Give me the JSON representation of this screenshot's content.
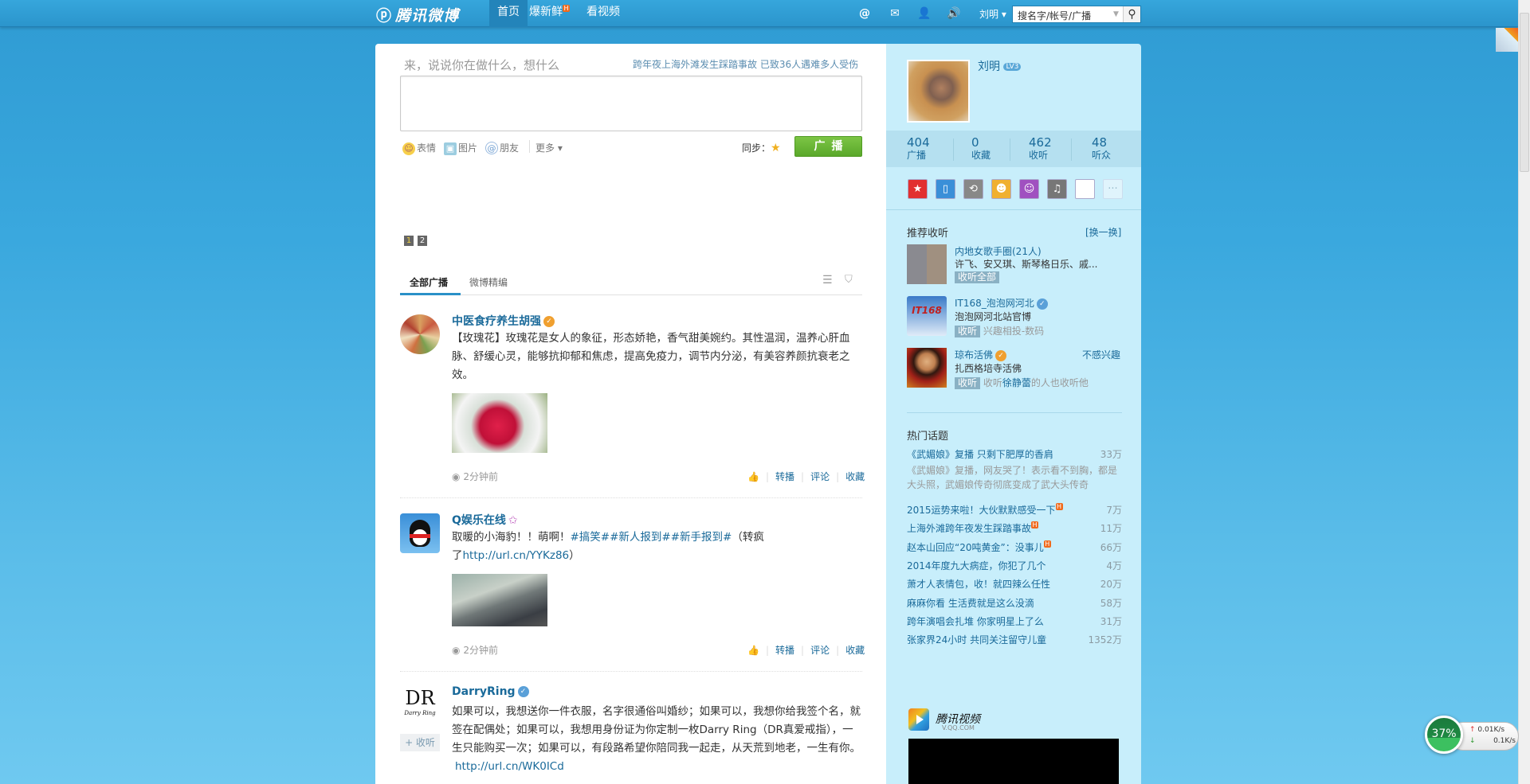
{
  "topbar": {
    "logo": "腾讯微博",
    "nav": [
      {
        "label": "首页",
        "active": true
      },
      {
        "label": "爆新鲜",
        "badge": "H"
      },
      {
        "label": "看视频"
      }
    ],
    "icons": [
      "at-icon",
      "mail-icon",
      "user-icon",
      "sound-icon"
    ],
    "user": "刘明",
    "search_placeholder": "搜名字/帐号/广播"
  },
  "composer": {
    "placeholder": "来，说说你在做什么，想什么",
    "hot_news": "跨年夜上海外滩发生踩踏事故  已致36人遇难多人受伤",
    "tools": [
      "表情",
      "图片",
      "朋友",
      "更多"
    ],
    "sync_label": "同步：",
    "post_button": "广播"
  },
  "pager": [
    "1",
    "2"
  ],
  "tabs": [
    "全部广播",
    "微博精编"
  ],
  "posts": [
    {
      "name": "中医食疗养生胡强",
      "badge": "verified-orange",
      "text": "【玫瑰花】玫瑰花是女人的象征，形态娇艳，香气甜美婉约。其性温润，温养心肝血脉、舒缓心灵，能够抗抑郁和焦虑，提高免疫力，调节内分泌，有美容养颜抗衰老之效。",
      "time": "2分钟前"
    },
    {
      "name": "Q娱乐在线",
      "badge": "star",
      "text_pre": "取暖的小海豹！！萌啊！",
      "tags": "#搞笑##新人报到##新手报到#",
      "text_mid": "（转疯了",
      "link": "http://url.cn/YYKz86",
      "text_post": "）",
      "time": "2分钟前"
    },
    {
      "name": "DarryRing",
      "badge": "verified-blue",
      "follow": "+ 收听",
      "text": "如果可以，我想送你一件衣服，名字很通俗叫婚纱；如果可以，我想你给我签个名，就签在配偶处；如果可以，我想用身份证为你定制一枚Darry Ring（DR真爱戒指），一生只能购买一次；如果可以，有段路希望你陪同我一起走，从天荒到地老，一生有你。",
      "link": "http://url.cn/WK0ICd"
    }
  ],
  "actions": [
    "转播",
    "评论",
    "收藏"
  ],
  "profile": {
    "name": "刘明",
    "level": "LV3",
    "stats": [
      {
        "value": "404",
        "label": "广播"
      },
      {
        "value": "0",
        "label": "收藏"
      },
      {
        "value": "462",
        "label": "收听"
      },
      {
        "value": "48",
        "label": "听众"
      }
    ]
  },
  "recommend": {
    "title": "推荐收听",
    "refresh": "[换一换]",
    "items": [
      {
        "name": "内地女歌手圈(21人)",
        "desc": "许飞、安又琪、斯琴格日乐、戚...",
        "btn": "收听全部"
      },
      {
        "name": "IT168_泡泡网河北",
        "desc": "泡泡网河北站官博",
        "btn": "收听",
        "note": "兴趣相投-数码"
      },
      {
        "name": "琼布活佛",
        "desc": "扎西格培寺活佛",
        "btn": "收听",
        "note_pre": "收听",
        "note_link": "徐静蕾",
        "note_post": "的人也收听他",
        "dismiss": "不感兴趣"
      }
    ]
  },
  "hot_topics": {
    "title": "热门话题",
    "lead": {
      "title": "《武媚娘》复播 只剩下肥厚的香肩",
      "count": "33万",
      "desc": "《武媚娘》复播，网友哭了！表示看不到胸，都是大头照，武媚娘传奇彻底变成了武大头传奇"
    },
    "items": [
      {
        "title": "2015运势来啦！大伙默默感受一下",
        "count": "7万",
        "hot": true
      },
      {
        "title": "上海外滩跨年夜发生踩踏事故",
        "count": "11万",
        "hot": true
      },
      {
        "title": "赵本山回应“20吨黄金”：没事儿",
        "count": "66万",
        "hot": true
      },
      {
        "title": "2014年度九大病症，你犯了几个",
        "count": "4万"
      },
      {
        "title": "萧才人表情包，收！就四辣么任性",
        "count": "20万"
      },
      {
        "title": "麻麻你看 生活费就是这么没滴",
        "count": "58万"
      },
      {
        "title": "跨年演唱会扎堆 你家明星上了么",
        "count": "31万"
      },
      {
        "title": "张家界24小时 共同关注留守儿童",
        "count": "1352万"
      }
    ]
  },
  "video": {
    "logo": "腾讯视频",
    "sub": "V.QQ.COM"
  },
  "netmon": {
    "percent": "37%",
    "up": "0.01K/s",
    "down": "0.1K/s"
  },
  "colors": {
    "accent": "#1a6a9a",
    "green": "#5aa82a",
    "sidebar": "#c8eefb"
  }
}
